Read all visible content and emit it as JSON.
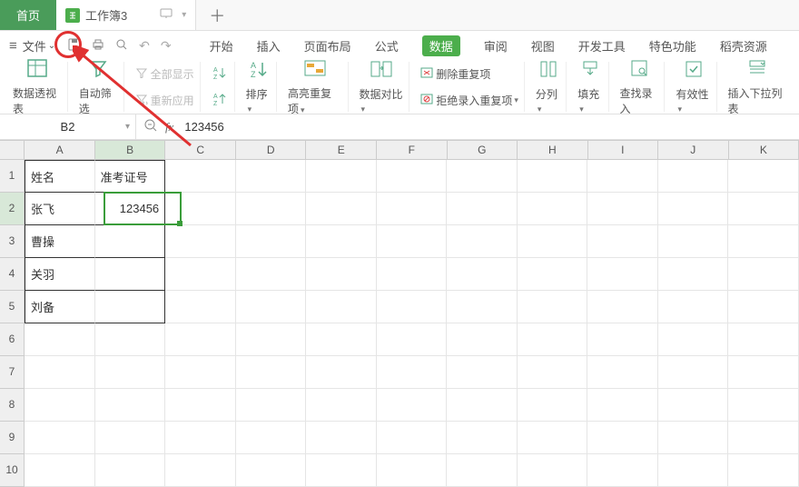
{
  "tabs": {
    "home": "首页",
    "doc_name": "工作簿3",
    "plus": "＋"
  },
  "menurow": {
    "file": "文件"
  },
  "ribbon_tabs": {
    "start": "开始",
    "insert": "插入",
    "layout": "页面布局",
    "formula": "公式",
    "data": "数据",
    "review": "审阅",
    "view": "视图",
    "devtools": "开发工具",
    "special": "特色功能",
    "resources": "稻壳资源"
  },
  "ribbon": {
    "pivot": "数据透视表",
    "autofilter": "自动筛选",
    "showall": "全部显示",
    "reapply": "重新应用",
    "sort": "排序",
    "highlight_dup": "高亮重复项",
    "data_compare": "数据对比",
    "remove_dup": "删除重复项",
    "reject_dup": "拒绝录入重复项",
    "text_to_col": "分列",
    "fill": "填充",
    "find_entry": "查找录入",
    "validation": "有效性",
    "insert_dropdown": "插入下拉列表"
  },
  "namebox": {
    "ref": "B2"
  },
  "formula": {
    "value": "123456"
  },
  "columns": [
    "A",
    "B",
    "C",
    "D",
    "E",
    "F",
    "G",
    "H",
    "I",
    "J",
    "K"
  ],
  "row_labels": [
    "1",
    "2",
    "3",
    "4",
    "5",
    "6",
    "7",
    "8",
    "9",
    "10"
  ],
  "cells": {
    "A1": "姓名",
    "B1": "准考证号",
    "A2": "张飞",
    "B2": "123456",
    "A3": "曹操",
    "A4": "关羽",
    "A5": "刘备"
  }
}
